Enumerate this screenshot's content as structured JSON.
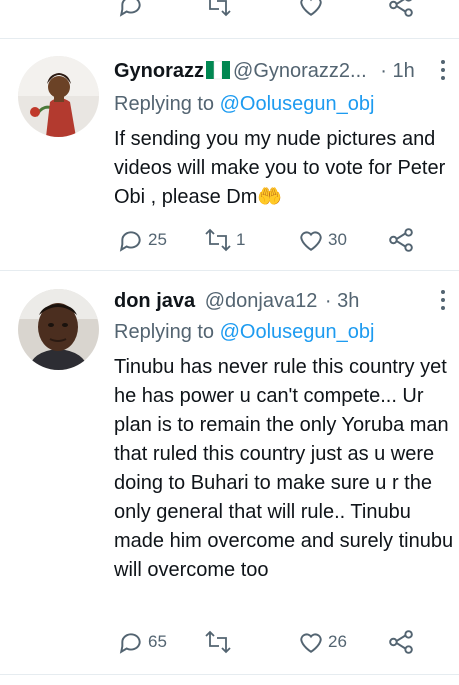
{
  "tweets": [
    {
      "name": "Gynorazz",
      "handle": "@Gynorazz2...",
      "separator": "·",
      "time": "1h",
      "replying_prefix": "Replying to ",
      "replying_to": "@Oolusegun_obj",
      "text": "If sending you my nude pictures and videos will make you to vote for Peter Obi , please Dm🤲",
      "reply_count": "25",
      "retweet_count": "1",
      "like_count": "30"
    },
    {
      "name": "don java",
      "handle": "@donjava12",
      "separator": "·",
      "time": "3h",
      "replying_prefix": "Replying to ",
      "replying_to": "@Oolusegun_obj",
      "text": "Tinubu has never rule this country yet he has power u can't compete... Ur plan is to remain the only Yoruba man that ruled this country just as u were doing to Buhari to make sure u r the only general that will rule.. Tinubu made him overcome and surely tinubu will overcome too",
      "reply_count": "65",
      "retweet_count": "",
      "like_count": "26"
    }
  ],
  "icons": {
    "reply": "reply-icon",
    "retweet": "retweet-icon",
    "like": "heart-icon",
    "share": "share-icon",
    "more": "more-vertical-icon",
    "flag": "nigeria-flag-icon"
  },
  "colors": {
    "accent": "#1d9bf0",
    "secondary_text": "#536471",
    "divider": "#e6ecf0",
    "flag_green": "#008751"
  }
}
